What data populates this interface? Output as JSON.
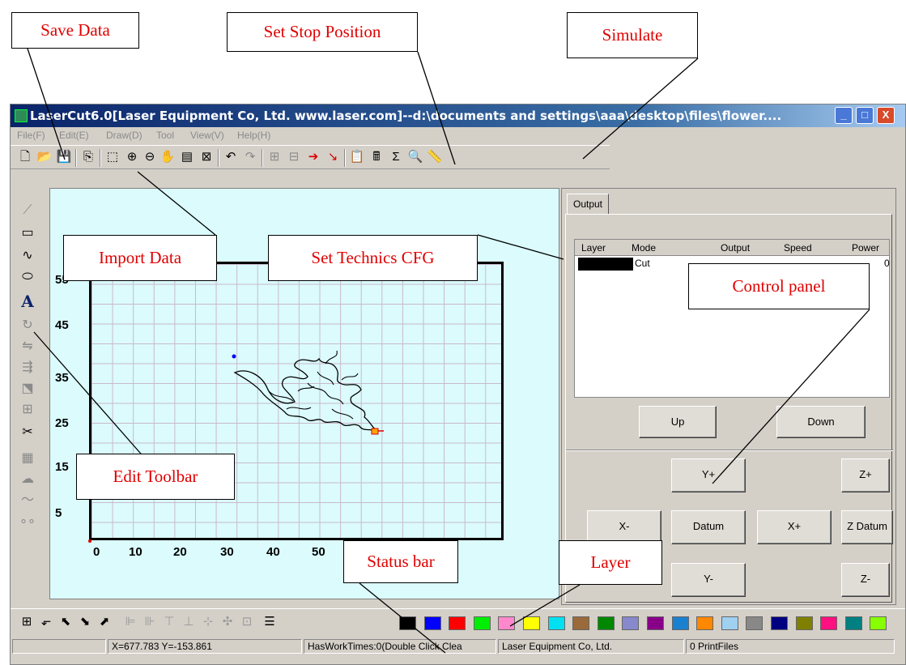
{
  "window": {
    "title": "LaserCut6.0[Laser Equipment Co, Ltd. www.laser.com]--d:\\documents and settings\\aaa\\desktop\\files\\flower....",
    "controls": [
      "_",
      "□",
      "X"
    ]
  },
  "menu": [
    "File(F)",
    "Edit(E)",
    "Draw(D)",
    "Tool",
    "View(V)",
    "Help(H)"
  ],
  "canvas": {
    "y_labels": [
      "5",
      "15",
      "25",
      "35",
      "45",
      "55"
    ],
    "x_labels": [
      "0",
      "10",
      "20",
      "30",
      "40",
      "50"
    ]
  },
  "panel": {
    "tab": "Output",
    "columns": [
      "Layer",
      "Mode",
      "Output",
      "Speed",
      "Power"
    ],
    "row": {
      "mode": "Cut",
      "power_tail": "0"
    },
    "buttons": {
      "up": "Up",
      "down": "Down",
      "y_plus": "Y+",
      "z_plus": "Z+",
      "x_minus": "X-",
      "datum": "Datum",
      "x_plus": "X+",
      "z_datum": "Z Datum",
      "y_minus": "Y-",
      "z_minus": "Z-"
    }
  },
  "palette": [
    "#000000",
    "#0000ff",
    "#ff0000",
    "#00ee00",
    "#ff88cc",
    "#ffff00",
    "#00e0f0",
    "#9a6a3a",
    "#008800",
    "#8888cc",
    "#880088",
    "#1a80d0",
    "#ff8800",
    "#a0d0f0",
    "#888888",
    "#000080",
    "#808000",
    "#ff1080",
    "#008080",
    "#88ff00"
  ],
  "status": {
    "coords": "X=677.783 Y=-153.861",
    "work": "HasWorkTimes:0(Double Click Clea",
    "company": "Laser Equipment Co, Ltd.",
    "files": "0 PrintFiles"
  },
  "annotations": {
    "save_data": "Save Data",
    "set_stop_position": "Set Stop Position",
    "simulate": "Simulate",
    "import_data": "Import Data",
    "set_technics_cfg": "Set Technics CFG",
    "control_panel": "Control panel",
    "edit_toolbar": "Edit Toolbar",
    "status_bar": "Status bar",
    "layer": "Layer"
  }
}
